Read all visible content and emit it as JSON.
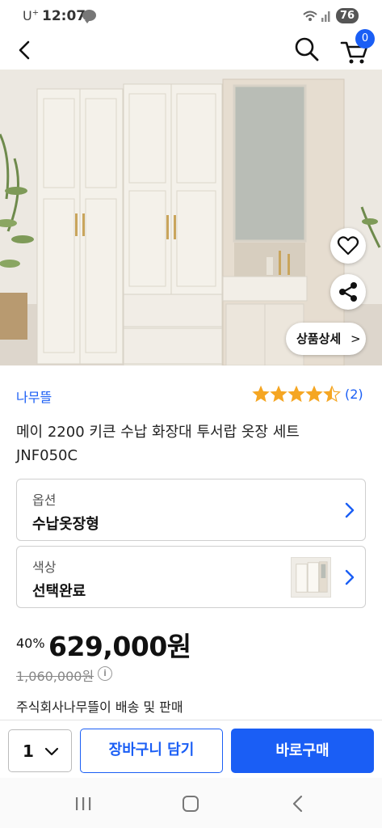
{
  "status_bar": {
    "carrier": "U",
    "carrier_sup": "+",
    "time": "12:07",
    "battery": "76",
    "icons": [
      "talk-icon",
      "wifi-icon",
      "signal-icon"
    ]
  },
  "header": {
    "icons": [
      "back-arrow-icon",
      "search-icon",
      "cart-icon"
    ],
    "cart_count": "0"
  },
  "product_image": {
    "detail_button_label": "상품상세",
    "detail_button_chevron": ">",
    "slide_count": 5,
    "active_slide": 2,
    "icons": [
      "heart-icon",
      "share-icon"
    ]
  },
  "product": {
    "brand": "나무뜰",
    "rating": 4.5,
    "review_count": "(2)",
    "title": "메이 2200 키큰 수납 화장대 투서랍 옷장 세트 JNF050C"
  },
  "options": [
    {
      "label": "옵션",
      "value": "수납옷장형"
    },
    {
      "label": "색상",
      "value": "선택완료"
    }
  ],
  "pricing": {
    "discount": "40%",
    "price": "629,000원",
    "original_price": "1,060,000원",
    "info_icon": "i"
  },
  "seller": "주식회사나무뜰이 배송 및 판매",
  "action_bar": {
    "quantity": "1",
    "add_to_cart_label": "장바구니 담기",
    "buy_now_label": "바로구매"
  },
  "colors": {
    "accent": "#1a5ef5",
    "star": "#f5a623"
  }
}
